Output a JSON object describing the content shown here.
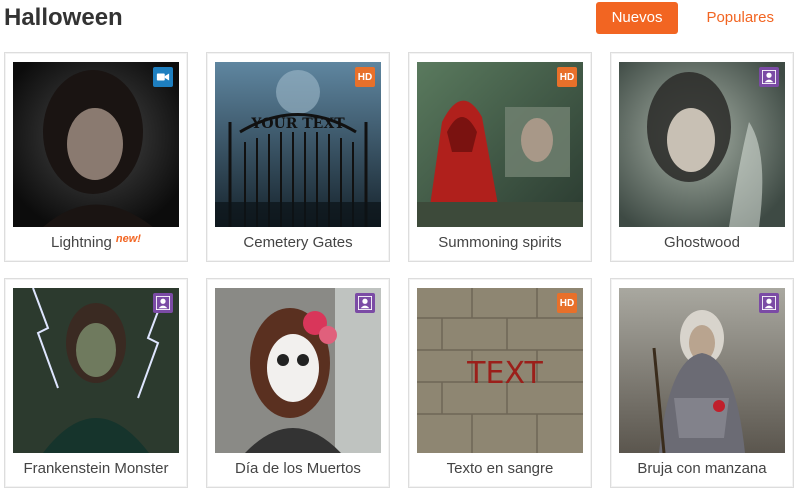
{
  "header": {
    "title": "Halloween",
    "tabs": [
      {
        "label": "Nuevos",
        "active": true
      },
      {
        "label": "Populares",
        "active": false
      }
    ]
  },
  "colors": {
    "accent": "#f26522",
    "video_badge": "#1e7fc0",
    "hd_badge": "#e8702a",
    "user_badge": "#7b4ba5"
  },
  "cards": [
    {
      "title": "Lightning",
      "new_label": "new!",
      "badge": "video",
      "badge_icon": "video-camera-icon"
    },
    {
      "title": "Cemetery Gates",
      "badge": "hd",
      "badge_text": "HD",
      "thumb_text": "YOUR TEXT"
    },
    {
      "title": "Summoning spirits",
      "badge": "hd",
      "badge_text": "HD"
    },
    {
      "title": "Ghostwood",
      "badge": "user",
      "badge_icon": "user-icon"
    },
    {
      "title": "Frankenstein Monster",
      "badge": "user",
      "badge_icon": "user-icon"
    },
    {
      "title": "Día de los Muertos",
      "badge": "user",
      "badge_icon": "user-icon"
    },
    {
      "title": "Texto en sangre",
      "badge": "hd",
      "badge_text": "HD",
      "thumb_text": "TEXT"
    },
    {
      "title": "Bruja con manzana",
      "badge": "user",
      "badge_icon": "user-icon"
    }
  ]
}
